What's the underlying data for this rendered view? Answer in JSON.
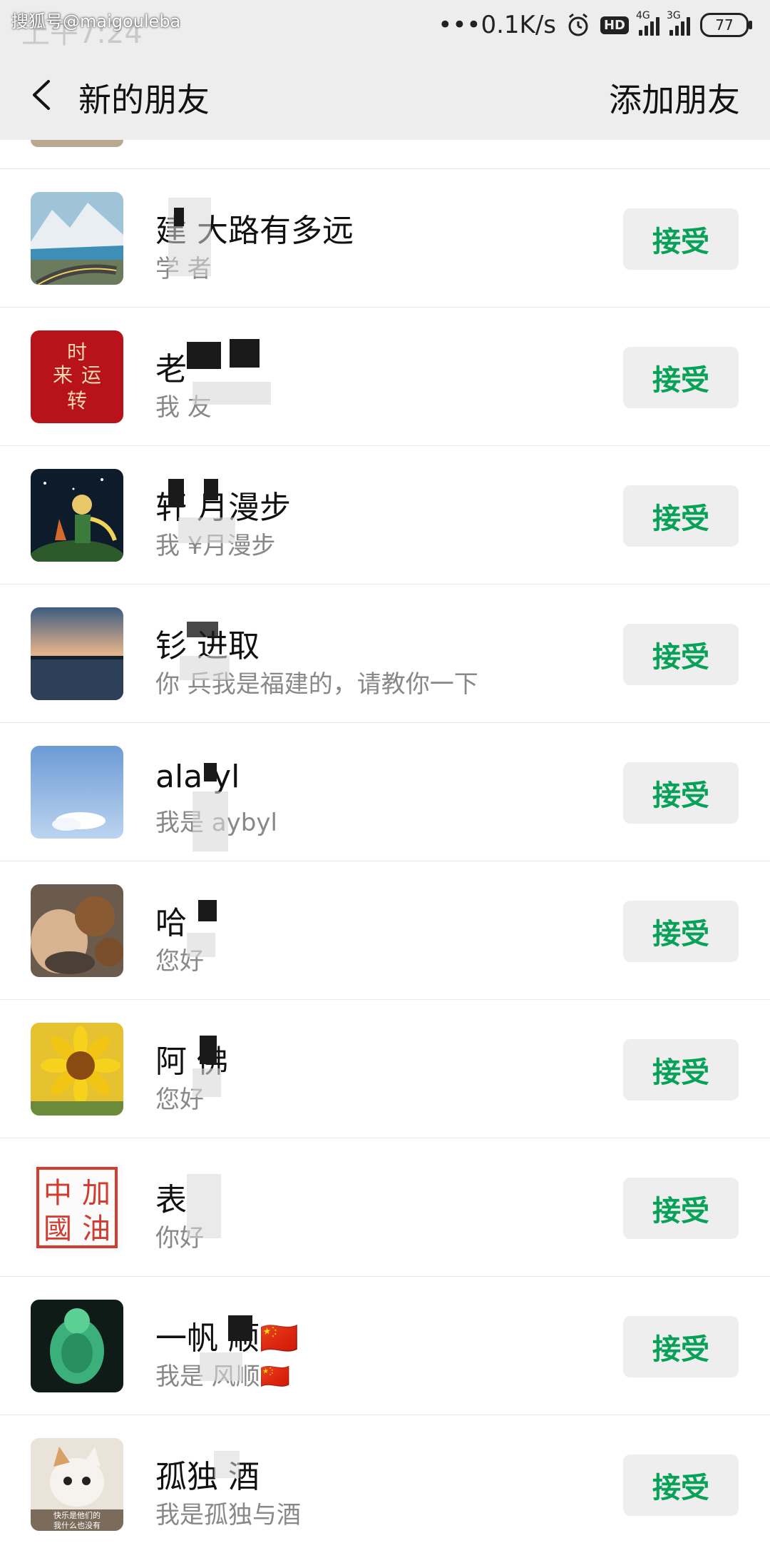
{
  "status_bar": {
    "watermark": "搜狐号@maigouleba",
    "clock": "上午7:24",
    "network_speed": "•••0.1K/s",
    "hd_label": "HD",
    "sig1_tag": "4G",
    "sig2_tag": "3G",
    "battery": "77"
  },
  "nav": {
    "title": "新的朋友",
    "action": "添加朋友"
  },
  "rows": [
    {
      "name": "建 大路有多远",
      "msg": "学 者",
      "action": "接受"
    },
    {
      "name": "老",
      "msg": "我 友",
      "action": "接受"
    },
    {
      "name": "轩 月漫步",
      "msg": "我 ¥月漫步",
      "action": "接受"
    },
    {
      "name": "钐 进取",
      "msg": "你 兵我是福建的，请教你一下",
      "action": "接受"
    },
    {
      "name": "ala yl",
      "msg": "我是 aybyl",
      "action": "接受"
    },
    {
      "name": "哈",
      "msg": "您好",
      "action": "接受"
    },
    {
      "name": "阿 佛",
      "msg": "您好",
      "action": "接受"
    },
    {
      "name": "表",
      "msg": "你好",
      "action": "接受"
    },
    {
      "name": "一帆 顺🇨🇳",
      "msg": "我是 风顺🇨🇳",
      "action": "接受"
    },
    {
      "name": "孤独 酒",
      "msg": "我是孤独与酒",
      "action": "接受"
    }
  ],
  "avatar_texts": {
    "row2": "时来运转",
    "row8": "中加國油",
    "row10": "快乐是他们的我什么也没有"
  }
}
